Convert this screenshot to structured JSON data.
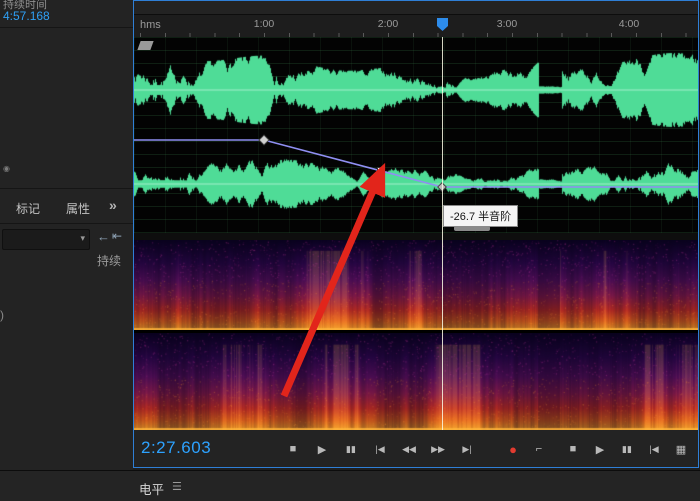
{
  "colors": {
    "accent_blue": "#2d8ceb",
    "time_blue": "#2da2ff",
    "wave_green": "#4fdc97",
    "record_red": "#e23b30",
    "arrow_red": "#e2251b"
  },
  "icons": {
    "chevron_down": "▾",
    "back_arrow": "←",
    "align_left": "⇤",
    "menu": "☰",
    "indicator": "◉"
  },
  "sidebar": {
    "header_label": "持续时间",
    "header_value": "4:57.168",
    "tabs": [
      {
        "label": "标记"
      },
      {
        "label": "属性"
      }
    ],
    "overflow_chevron": "»",
    "dropdown_value": "",
    "row_label": "持续",
    "partial_text": ")"
  },
  "ruler": {
    "unit_label": "hms",
    "ticks": [
      {
        "label": "1:00"
      },
      {
        "label": "2:00"
      },
      {
        "label": "3:00"
      },
      {
        "label": "4:00"
      }
    ]
  },
  "envelope": {
    "tooltip": "-26.7 半音阶"
  },
  "transport": {
    "time_display": "2:27.603",
    "left_buttons": [
      {
        "name": "stop-button",
        "glyph": "■"
      },
      {
        "name": "play-button",
        "glyph": "▶"
      },
      {
        "name": "pause-button",
        "glyph": "▮▮"
      },
      {
        "name": "prev-button",
        "glyph": "|◀"
      },
      {
        "name": "rewind-button",
        "glyph": "◀◀"
      },
      {
        "name": "fast-forward-button",
        "glyph": "▶▶"
      },
      {
        "name": "next-button",
        "glyph": "▶|"
      },
      {
        "name": "record-button",
        "glyph": "●",
        "red": true
      },
      {
        "name": "skip-selection-button",
        "glyph": "⌐"
      }
    ],
    "right_buttons": [
      {
        "name": "zoom-out-button",
        "glyph": "■"
      },
      {
        "name": "zoom-in-button",
        "glyph": "▶"
      },
      {
        "name": "zoom-amplitude-button",
        "glyph": "▮▮"
      },
      {
        "name": "zoom-selection-button",
        "glyph": "|◀"
      },
      {
        "name": "zoom-full-button",
        "glyph": "▦"
      }
    ]
  },
  "bottom_bar": {
    "tab_label": "电平"
  }
}
